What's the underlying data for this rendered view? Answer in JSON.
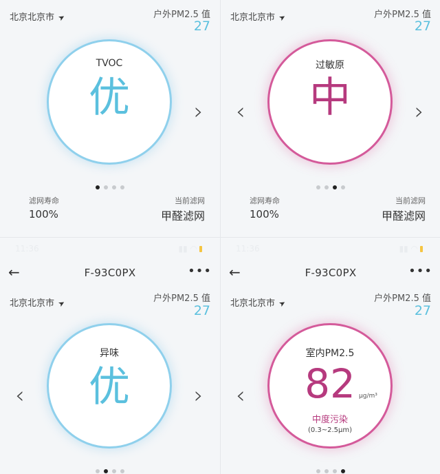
{
  "panels": [
    {
      "location": "北京北京市",
      "outdoor_label": "户外PM2.5 值",
      "outdoor_value": "27",
      "metric_label": "TVOC",
      "metric_grade": "优",
      "filter_life_label": "滤网寿命",
      "filter_life_value": "100%",
      "current_filter_label": "当前滤网",
      "current_filter_value": "甲醛滤网",
      "page_index": 1,
      "page_count": 4
    },
    {
      "location": "北京北京市",
      "outdoor_label": "户外PM2.5 值",
      "outdoor_value": "27",
      "metric_label": "过敏原",
      "metric_grade": "中",
      "filter_life_label": "滤网寿命",
      "filter_life_value": "100%",
      "current_filter_label": "当前滤网",
      "current_filter_value": "甲醛滤网",
      "page_index": 3,
      "page_count": 4
    },
    {
      "status_time": "11:36",
      "nav_title": "F-93C0PX",
      "location": "北京北京市",
      "outdoor_label": "户外PM2.5 值",
      "outdoor_value": "27",
      "metric_label": "异味",
      "metric_grade": "优",
      "page_index": 2,
      "page_count": 4
    },
    {
      "status_time": "11:36",
      "nav_title": "F-93C0PX",
      "location": "北京北京市",
      "outdoor_label": "户外PM2.5 值",
      "outdoor_value": "27",
      "metric_label": "室内PM2.5",
      "pm_value": "82",
      "pm_unit": "μg/m³",
      "pm_level": "中度污染",
      "pm_range": "(0.3~2.5μm)",
      "page_index": 4,
      "page_count": 4
    }
  ],
  "icons": {
    "back": "←",
    "more": "•••",
    "location_arrow": "➤",
    "chevron_left": "‹",
    "chevron_right": "›"
  },
  "colors": {
    "good_blue": "#5bc0de",
    "moderate_magenta": "#b63a7e",
    "ring_blue": "#8fd0ec",
    "ring_pink": "#d45a9a"
  }
}
